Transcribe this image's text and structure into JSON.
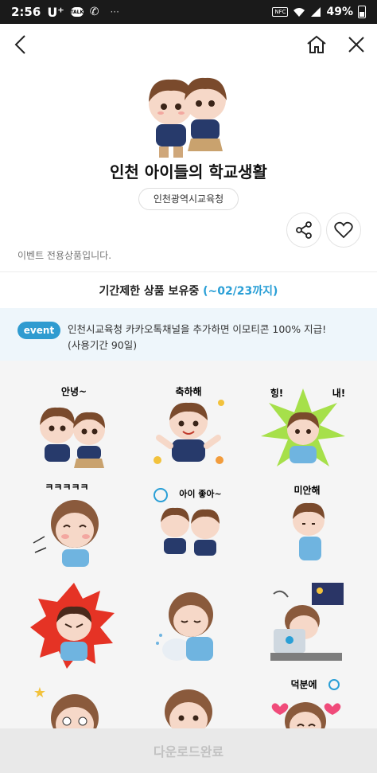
{
  "status_bar": {
    "time": "2:56",
    "carrier": "U⁺",
    "talk_badge": "TALK",
    "battery": "49%",
    "nfc": "NFC"
  },
  "nav": {
    "back_icon": "chevron-left-icon",
    "home_icon": "home-icon",
    "close_icon": "close-icon"
  },
  "product": {
    "title": "인천 아이들의 학교생활",
    "publisher": "인천광역시교육청",
    "event_only_note": "이벤트 전용상품입니다."
  },
  "period": {
    "label": "기간제한 상품 보유중",
    "date": "(~02/23까지)"
  },
  "event_banner": {
    "badge": "event",
    "line1": "인천시교육청 카카오톡채널을 추가하면 이모티콘 100% 지급!",
    "line2": "(사용기간 90일)"
  },
  "stickers": [
    {
      "caption": "안녕~"
    },
    {
      "caption": "축하해"
    },
    {
      "caption": "힝!",
      "caption2": "내!"
    },
    {
      "caption": "ㅋㅋㅋㅋㅋ"
    },
    {
      "caption": "아이 좋아~"
    },
    {
      "caption": "미안해"
    },
    {
      "caption": ""
    },
    {
      "caption": ""
    },
    {
      "caption": ""
    },
    {
      "caption": ""
    },
    {
      "caption": ""
    },
    {
      "caption": "덕분에"
    }
  ],
  "download": {
    "label": "다운로드완료"
  },
  "colors": {
    "accent": "#2a9fd6",
    "badge": "#2f9bd0",
    "banner_bg": "#eef6fb",
    "grid_bg": "#f5f5f5"
  }
}
